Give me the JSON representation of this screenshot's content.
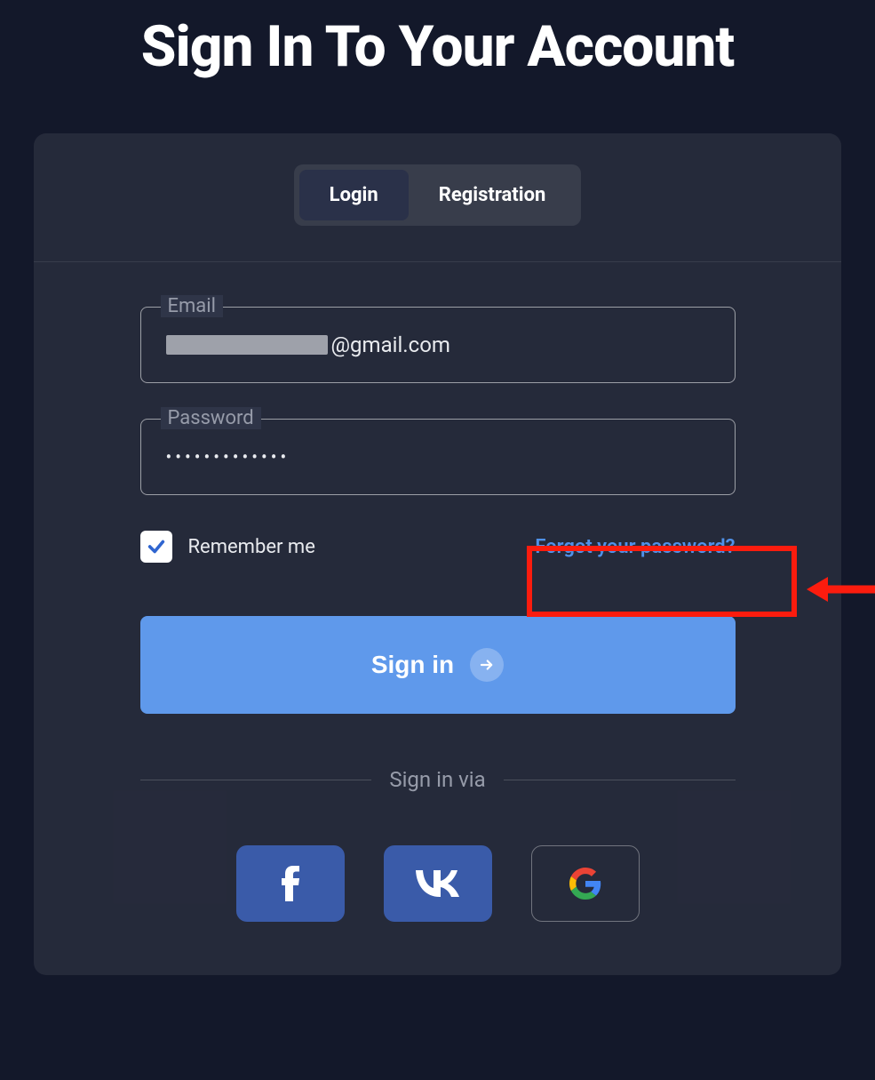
{
  "title": "Sign In To Your Account",
  "tabs": {
    "login": "Login",
    "registration": "Registration"
  },
  "fields": {
    "email": {
      "label": "Email",
      "value_suffix": "@gmail.com"
    },
    "password": {
      "label": "Password",
      "masked": "•••••••••••••"
    }
  },
  "remember": {
    "label": "Remember me",
    "checked": true
  },
  "forgot_link": "Forgot your password?",
  "signin_button": "Sign in",
  "divider_label": "Sign in via",
  "social": {
    "facebook": "facebook",
    "vk": "vk",
    "google": "google"
  },
  "colors": {
    "accent": "#5f99eb",
    "link": "#4f91e8",
    "highlight": "#fb1c0e"
  }
}
